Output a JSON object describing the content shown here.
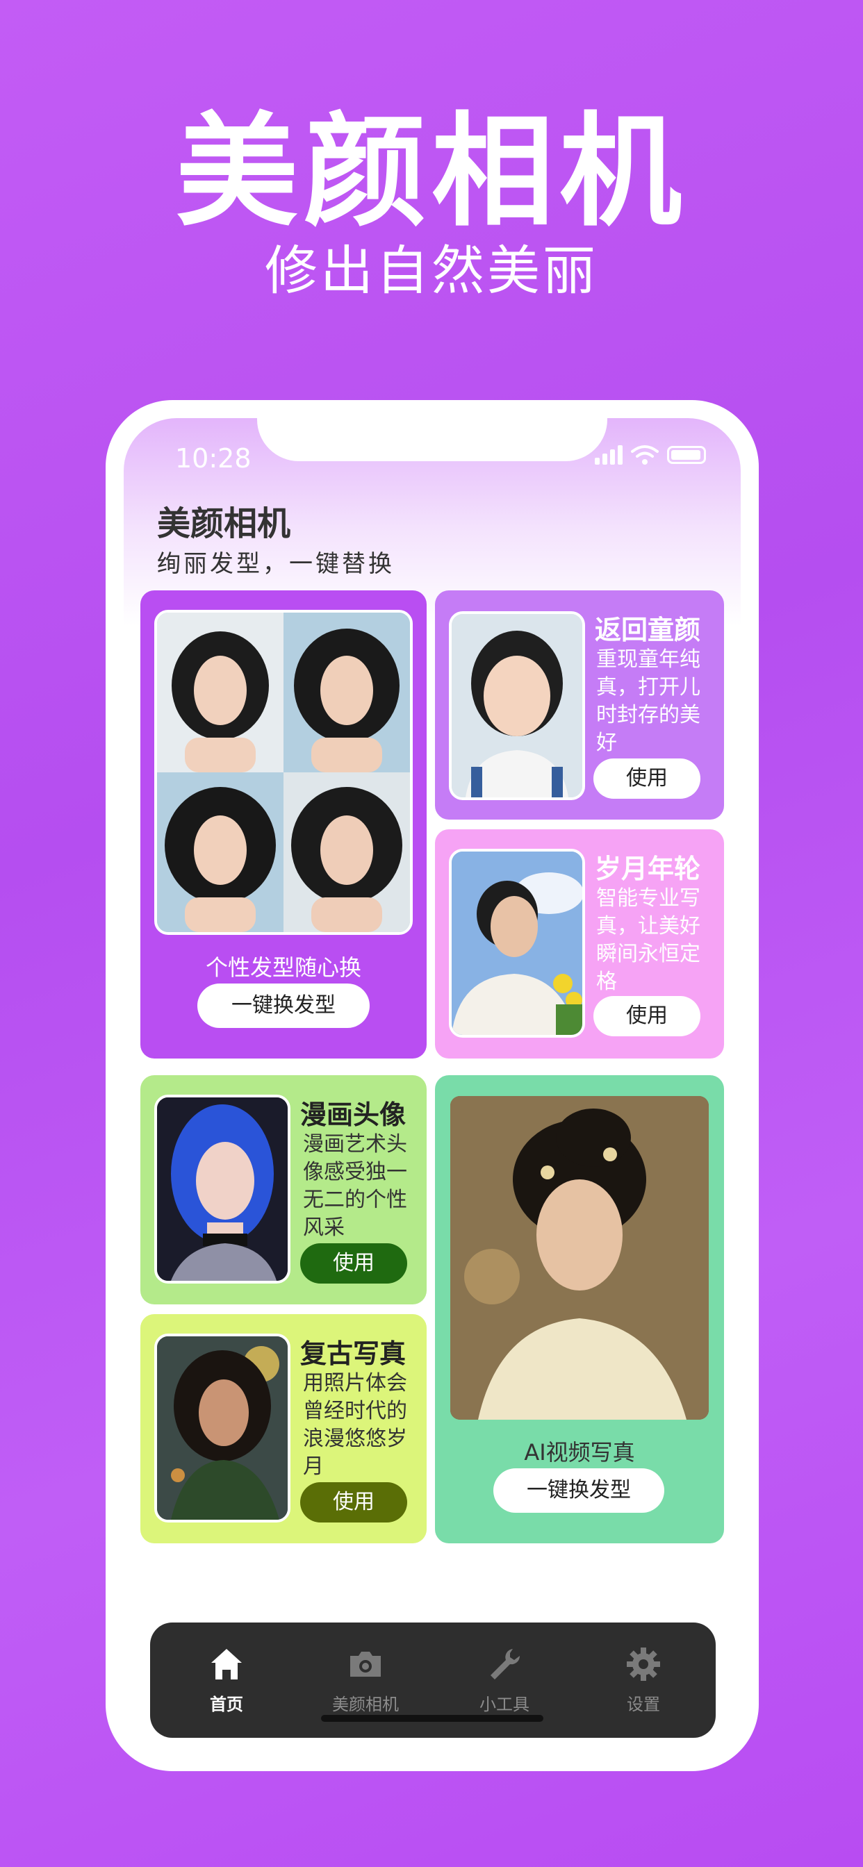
{
  "headline": {
    "title": "美颜相机",
    "subtitle": "修出自然美丽"
  },
  "status": {
    "time": "10:28"
  },
  "app": {
    "title": "美颜相机",
    "subtitle": "绚丽发型，一键替换"
  },
  "cards": {
    "hairstyle": {
      "caption": "个性发型随心换",
      "button": "一键换发型",
      "color": "#b94ef2"
    },
    "childhood": {
      "title": "返回童颜",
      "desc": "重现童年纯真，打开儿时封存的美好",
      "button": "使用",
      "color": "#c57cf6"
    },
    "years": {
      "title": "岁月年轮",
      "desc": "智能专业写真，让美好瞬间永恒定格",
      "button": "使用",
      "color": "#f6a3f5"
    },
    "comic": {
      "title": "漫画头像",
      "desc": "漫画艺术头像感受独一无二的个性风采",
      "button": "使用",
      "color": "#b4ea8a"
    },
    "retro": {
      "title": "复古写真",
      "desc": "用照片体会曾经时代的浪漫悠悠岁月",
      "button": "使用",
      "color": "#dcf57a"
    },
    "video": {
      "caption": "AI视频写真",
      "button": "一键换发型",
      "color": "#79dca9"
    }
  },
  "tabs": [
    {
      "label": "首页",
      "icon": "home-icon"
    },
    {
      "label": "美颜相机",
      "icon": "camera-icon"
    },
    {
      "label": "小工具",
      "icon": "wrench-icon"
    },
    {
      "label": "设置",
      "icon": "gear-icon"
    }
  ]
}
